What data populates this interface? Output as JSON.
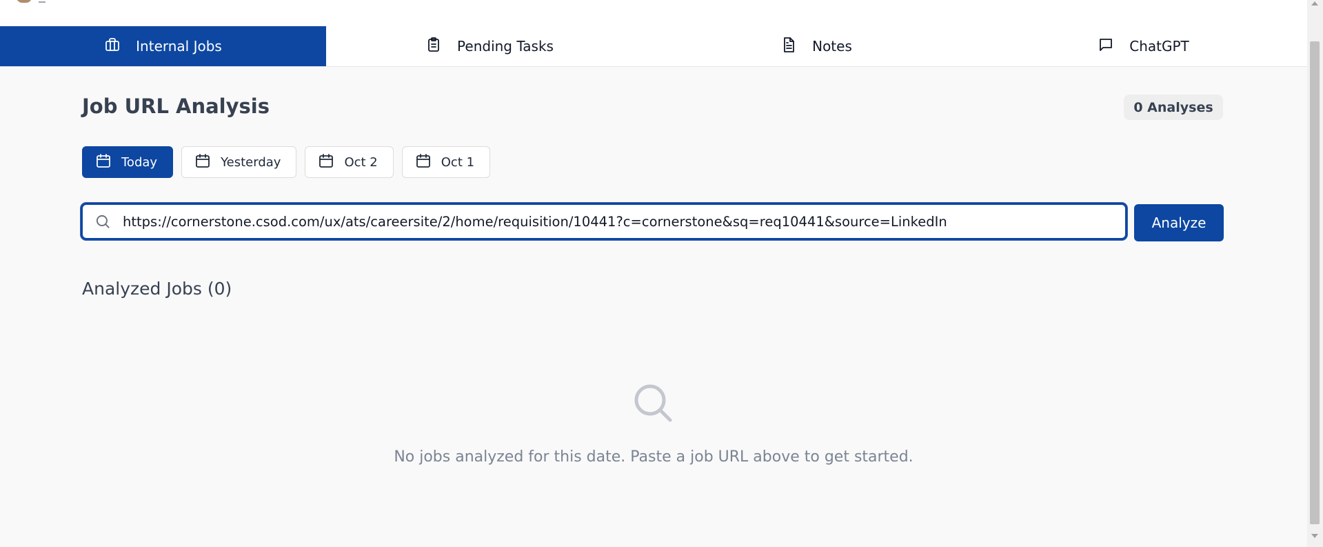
{
  "tabs": [
    {
      "label": "Internal Jobs",
      "icon": "briefcase-icon",
      "active": true
    },
    {
      "label": "Pending Tasks",
      "icon": "clipboard-icon",
      "active": false
    },
    {
      "label": "Notes",
      "icon": "document-icon",
      "active": false
    },
    {
      "label": "ChatGPT",
      "icon": "chat-icon",
      "active": false
    }
  ],
  "main": {
    "title": "Job URL Analysis",
    "count_badge": "0 Analyses",
    "date_filters": [
      {
        "label": "Today",
        "active": true
      },
      {
        "label": "Yesterday",
        "active": false
      },
      {
        "label": "Oct 2",
        "active": false
      },
      {
        "label": "Oct 1",
        "active": false
      }
    ],
    "url_input": {
      "value": "https://cornerstone.csod.com/ux/ats/careersite/2/home/requisition/10441?c=cornerstone&sq=req10441&source=LinkedIn",
      "icon": "search-icon"
    },
    "analyze_label": "Analyze",
    "analyzed_title": "Analyzed Jobs (0)",
    "empty_state": {
      "icon": "search-icon",
      "message": "No jobs analyzed for this date. Paste a job URL above to get started."
    }
  },
  "colors": {
    "primary": "#0d47a1",
    "background": "#f9f9f9",
    "muted_text": "#7b8494"
  }
}
